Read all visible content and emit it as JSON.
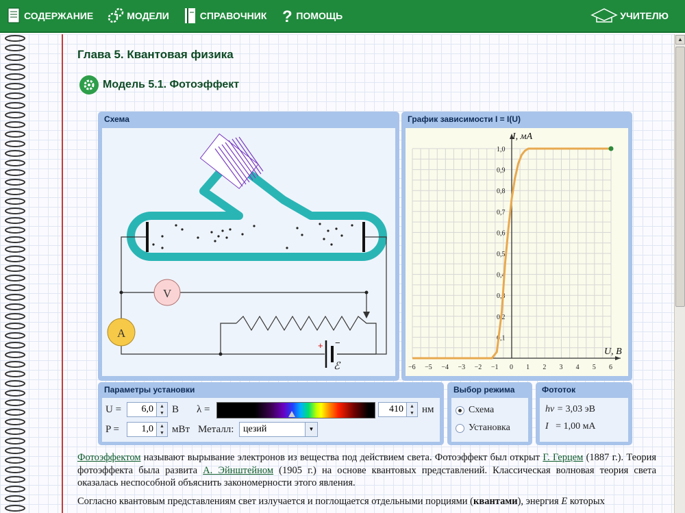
{
  "nav": {
    "contents": "СОДЕРЖАНИЕ",
    "models": "МОДЕЛИ",
    "reference": "СПРАВОЧНИК",
    "help": "ПОМОЩЬ",
    "teacher": "УЧИТЕЛЮ"
  },
  "chapter_title": "Глава 5. Квантовая физика",
  "model_title": "Модель 5.1.  Фотоэффект",
  "scheme": {
    "title": "Схема",
    "voltmeter": "V",
    "ammeter": "A",
    "battery_plus": "+",
    "battery_minus": "−",
    "battery_symbol": "ℰ"
  },
  "graph": {
    "title": "График зависимости I = I(U)",
    "ylabel": "I, мА",
    "xlabel": "U, В"
  },
  "chart_data": {
    "type": "line",
    "title": "График зависимости I = I(U)",
    "xlabel": "U, В",
    "ylabel": "I, мА",
    "xlim": [
      -6,
      6
    ],
    "ylim": [
      0,
      1.0
    ],
    "xticks": [
      "−6",
      "−5",
      "−4",
      "−3",
      "−2",
      "−1",
      "0",
      "1",
      "2",
      "3",
      "4",
      "5",
      "6"
    ],
    "yticks": [
      "0,1",
      "0,2",
      "0,3",
      "0,4",
      "0,5",
      "0,6",
      "0,7",
      "0,8",
      "0,9",
      "1,0"
    ],
    "series": [
      {
        "x": [
          -6,
          -1.2,
          -0.9,
          -0.6,
          -0.4,
          -0.2,
          0,
          0.2,
          0.4,
          0.6,
          0.8,
          1.0,
          1.2,
          1.5,
          2,
          6
        ],
        "y": [
          0,
          0,
          0.03,
          0.22,
          0.45,
          0.62,
          0.76,
          0.86,
          0.93,
          0.97,
          0.99,
          1.0,
          1.0,
          1.0,
          1.0,
          1.0
        ],
        "color": "#e8a94f"
      }
    ],
    "grid": true,
    "marker_point": {
      "x": 6,
      "y": 1.0,
      "color": "#2c8a3a"
    }
  },
  "params": {
    "title": "Параметры установки",
    "u_label": "U =",
    "u_value": "6,0",
    "u_unit": "В",
    "p_label": "P =",
    "p_value": "1,0",
    "p_unit": "мВт",
    "lambda_label": "λ =",
    "lambda_value": "410",
    "lambda_unit": "нм",
    "metal_label": "Металл:",
    "metal_value": "цезий"
  },
  "mode": {
    "title": "Выбор режима",
    "option_scheme": "Схема",
    "option_setup": "Установка",
    "selected": "Схема"
  },
  "phototok": {
    "title": "Фототок",
    "hv_label": "hν = ",
    "hv_value": "3,03 эВ",
    "i_label": "I",
    "i_value": "=  1,00 мА"
  },
  "text": {
    "p1_link1": "Фотоэффектом",
    "p1_a": " называют вырывание электронов из вещества под действием света. Фотоэффект был открыт ",
    "p1_link2": "Г. Герцем",
    "p1_b": " (1887 г.). Теория фотоэффекта была развита ",
    "p1_link3": "А. Эйнштейном",
    "p1_c": " (1905 г.) на основе квантовых представлений. Классическая волновая теория света оказалась неспособной объяснить закономерности этого явления.",
    "p2_a": "Согласно квантовым представлениям свет излучается и поглощается отдельными порциями (",
    "p2_bold": "квантами",
    "p2_b": "), энергия ",
    "p2_e": "E",
    "p2_c": " которых"
  },
  "colors": {
    "topbar": "#1f8a3c",
    "panel": "#a9c4ea",
    "tube": "#2ab5b5",
    "curve": "#e8a94f",
    "margin_line": "#c23b3b"
  }
}
